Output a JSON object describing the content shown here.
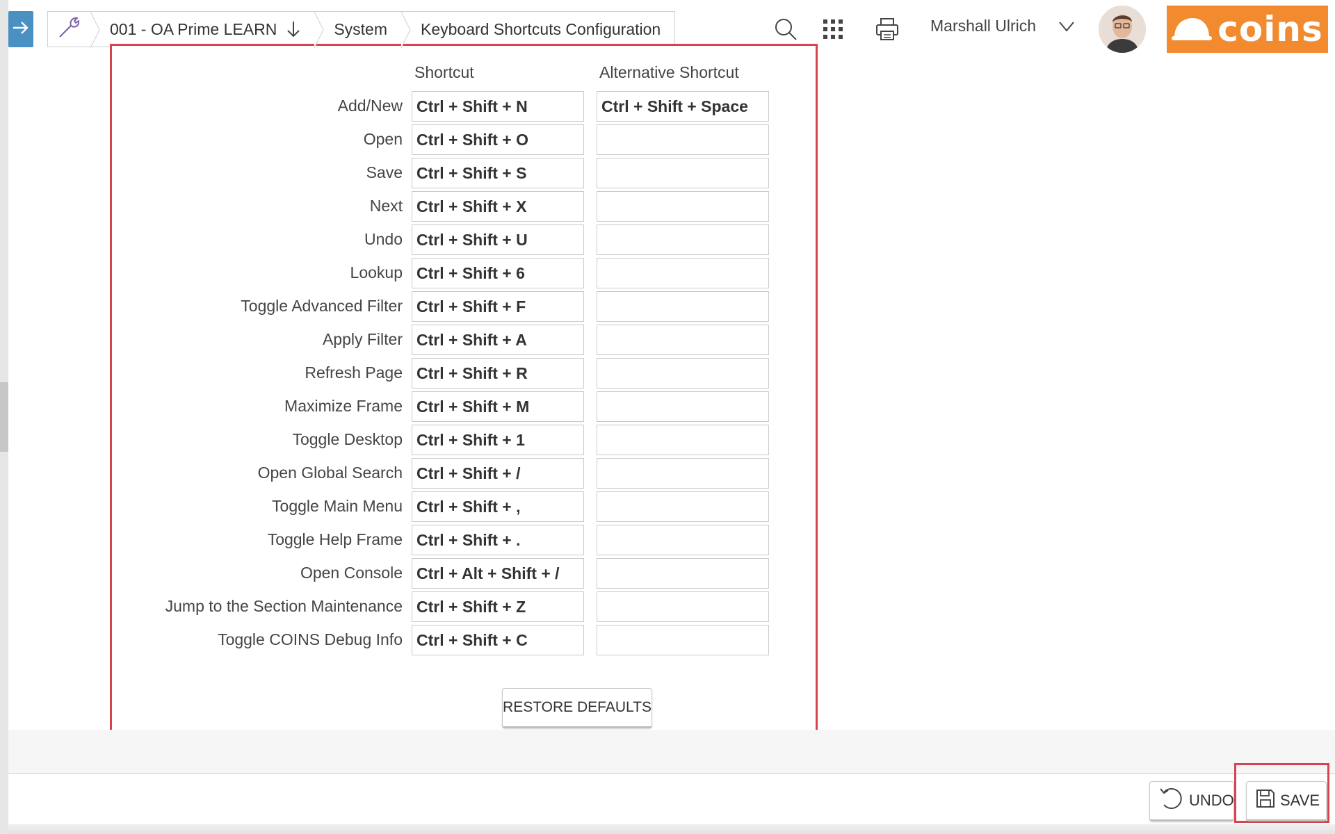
{
  "breadcrumb": {
    "company": "001 - OA Prime LEARN",
    "module": "System",
    "page": "Keyboard Shortcuts Configuration"
  },
  "user": {
    "name": "Marshall Ulrich"
  },
  "brand": {
    "logo_text": "coins",
    "accent_color": "#f28a30",
    "highlight_color": "#d9434f"
  },
  "form": {
    "col_shortcut": "Shortcut",
    "col_alternative": "Alternative Shortcut",
    "rows": [
      {
        "label": "Add/New",
        "shortcut": "Ctrl + Shift + N",
        "alternative": "Ctrl + Shift + Space"
      },
      {
        "label": "Open",
        "shortcut": "Ctrl + Shift + O",
        "alternative": ""
      },
      {
        "label": "Save",
        "shortcut": "Ctrl + Shift + S",
        "alternative": ""
      },
      {
        "label": "Next",
        "shortcut": "Ctrl + Shift + X",
        "alternative": ""
      },
      {
        "label": "Undo",
        "shortcut": "Ctrl + Shift + U",
        "alternative": ""
      },
      {
        "label": "Lookup",
        "shortcut": "Ctrl + Shift + 6",
        "alternative": ""
      },
      {
        "label": "Toggle Advanced Filter",
        "shortcut": "Ctrl + Shift + F",
        "alternative": ""
      },
      {
        "label": "Apply Filter",
        "shortcut": "Ctrl + Shift + A",
        "alternative": ""
      },
      {
        "label": "Refresh Page",
        "shortcut": "Ctrl + Shift + R",
        "alternative": ""
      },
      {
        "label": "Maximize Frame",
        "shortcut": "Ctrl + Shift + M",
        "alternative": ""
      },
      {
        "label": "Toggle Desktop",
        "shortcut": "Ctrl + Shift + 1",
        "alternative": ""
      },
      {
        "label": "Open Global Search",
        "shortcut": "Ctrl + Shift + /",
        "alternative": ""
      },
      {
        "label": "Toggle Main Menu",
        "shortcut": "Ctrl + Shift + ,",
        "alternative": ""
      },
      {
        "label": "Toggle Help Frame",
        "shortcut": "Ctrl + Shift + .",
        "alternative": ""
      },
      {
        "label": "Open Console",
        "shortcut": "Ctrl + Alt + Shift + /",
        "alternative": ""
      },
      {
        "label": "Jump to the Section Maintenance",
        "shortcut": "Ctrl + Shift + Z",
        "alternative": ""
      },
      {
        "label": "Toggle COINS Debug Info",
        "shortcut": "Ctrl + Shift + C",
        "alternative": ""
      }
    ],
    "restore_label": "RESTORE DEFAULTS"
  },
  "footer": {
    "undo_label": "UNDO",
    "save_label": "SAVE"
  },
  "icons": {
    "menu": "arrow-right-icon",
    "tools": "wrench-icon",
    "company_dropdown": "arrow-down-icon",
    "search": "search-icon",
    "apps": "grid-icon",
    "print": "printer-icon",
    "user_menu": "chevron-down-icon",
    "undo": "undo-icon",
    "save": "floppy-disk-icon"
  }
}
